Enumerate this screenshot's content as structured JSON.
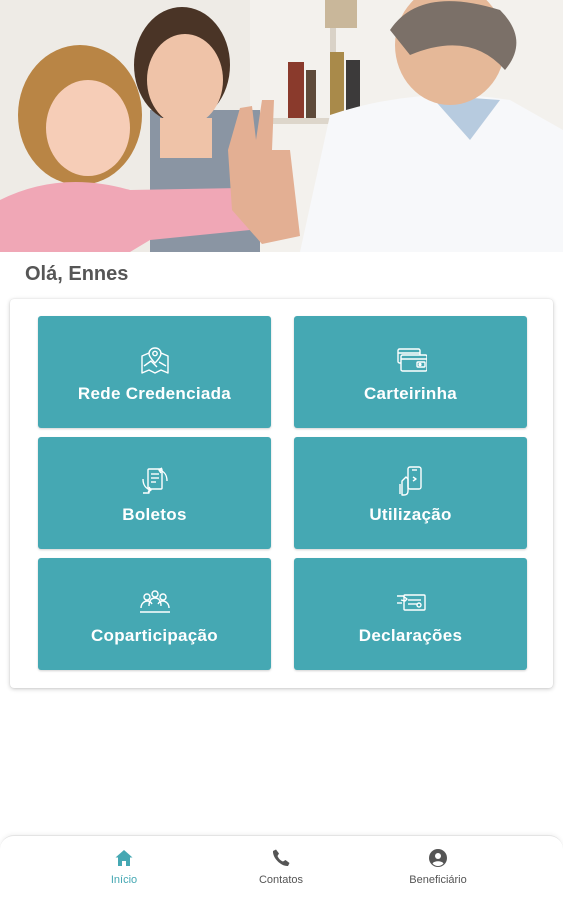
{
  "hero": {
    "image": "family-doctor-photo"
  },
  "greeting": "Olá, Ennes",
  "colors": {
    "accent": "#45a8b3",
    "tile_text": "#ffffff",
    "nav_inactive": "#555555"
  },
  "menu": [
    {
      "label": "Rede Credenciada",
      "icon": "map-pin-icon"
    },
    {
      "label": "Carteirinha",
      "icon": "wallet-card-icon"
    },
    {
      "label": "Boletos",
      "icon": "bill-exchange-icon"
    },
    {
      "label": "Utilização",
      "icon": "phone-usage-icon"
    },
    {
      "label": "Coparticipação",
      "icon": "people-group-icon"
    },
    {
      "label": "Declarações",
      "icon": "document-hand-icon"
    }
  ],
  "bottom_nav": [
    {
      "label": "Início",
      "icon": "home-icon",
      "active": true
    },
    {
      "label": "Contatos",
      "icon": "phone-icon",
      "active": false
    },
    {
      "label": "Beneficiário",
      "icon": "user-circle-icon",
      "active": false
    }
  ]
}
